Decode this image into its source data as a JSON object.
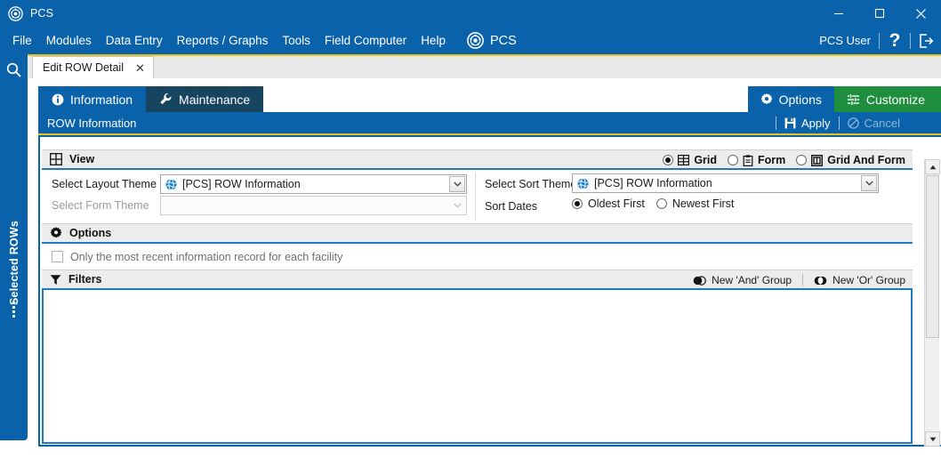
{
  "window": {
    "app_logo_icon": "pcs-logo-icon",
    "title": "PCS",
    "minimize_icon": "minimize-icon",
    "maximize_icon": "maximize-icon",
    "close_icon": "close-icon"
  },
  "menubar": {
    "items": [
      {
        "label": "File"
      },
      {
        "label": "Modules"
      },
      {
        "label": "Data Entry"
      },
      {
        "label": "Reports / Graphs"
      },
      {
        "label": "Tools"
      },
      {
        "label": "Field Computer"
      },
      {
        "label": "Help"
      }
    ],
    "brand_icon": "pcs-logo-icon",
    "brand_label": "PCS",
    "user_label": "PCS User",
    "help_icon": "question-mark-icon",
    "logout_icon": "logout-icon"
  },
  "rail": {
    "search_icon": "search-icon",
    "panel_label": "Selected ROWs",
    "grip_icon": "drag-grip-icon"
  },
  "document_tab": {
    "label": "Edit ROW Detail",
    "close_icon": "close-icon"
  },
  "form_tabs": [
    {
      "label": "Information",
      "icon": "info-circle-icon",
      "active": true
    },
    {
      "label": "Maintenance",
      "icon": "wrench-icon",
      "active": false
    }
  ],
  "top_right_buttons": [
    {
      "label": "Options",
      "icon": "gear-icon",
      "color": "#0a62ab"
    },
    {
      "label": "Customize",
      "icon": "sliders-icon",
      "color": "#1f8f3f"
    }
  ],
  "header_bar": {
    "title": "ROW Information",
    "apply_label": "Apply",
    "apply_icon": "save-disk-icon",
    "cancel_label": "Cancel",
    "cancel_icon": "cancel-circle-icon",
    "cancel_disabled": true
  },
  "view_section": {
    "header_icon": "grid-icon",
    "header_label": "View",
    "view_modes": [
      {
        "label": "Grid",
        "icon": "grid-icon",
        "selected": true
      },
      {
        "label": "Form",
        "icon": "clipboard-icon",
        "selected": false
      },
      {
        "label": "Grid And Form",
        "icon": "grid-and-form-icon",
        "selected": false
      }
    ],
    "layout_theme_label": "Select Layout Theme",
    "layout_theme_value": "[PCS] ROW Information",
    "layout_theme_icon": "globe-icon",
    "form_theme_label": "Select Form Theme",
    "form_theme_value": "",
    "form_theme_disabled": true,
    "sort_theme_label": "Select Sort Theme",
    "sort_theme_value": "[PCS] ROW Information",
    "sort_theme_icon": "globe-icon",
    "sort_dates_label": "Sort Dates",
    "sort_dates_options": [
      {
        "label": "Oldest First",
        "selected": true
      },
      {
        "label": "Newest First",
        "selected": false
      }
    ]
  },
  "options_section": {
    "header_icon": "gear-icon",
    "header_label": "Options",
    "checkbox_label": "Only the most recent information record for each facility",
    "checkbox_checked": false
  },
  "filters_section": {
    "header_icon": "funnel-icon",
    "header_label": "Filters",
    "new_and_group_label": "New 'And' Group",
    "new_and_group_icon": "and-venn-icon",
    "new_or_group_label": "New 'Or' Group",
    "new_or_group_icon": "or-venn-icon"
  },
  "scrollbar": {
    "up_icon": "caret-up-icon",
    "down_icon": "caret-down-icon",
    "thumb": "scroll-thumb"
  },
  "colors": {
    "brand_blue": "#0a62ab",
    "dark_blue": "#17455f",
    "green": "#1f8f3f",
    "gold": "#e8c51c",
    "section_border": "#1f7bc1"
  }
}
